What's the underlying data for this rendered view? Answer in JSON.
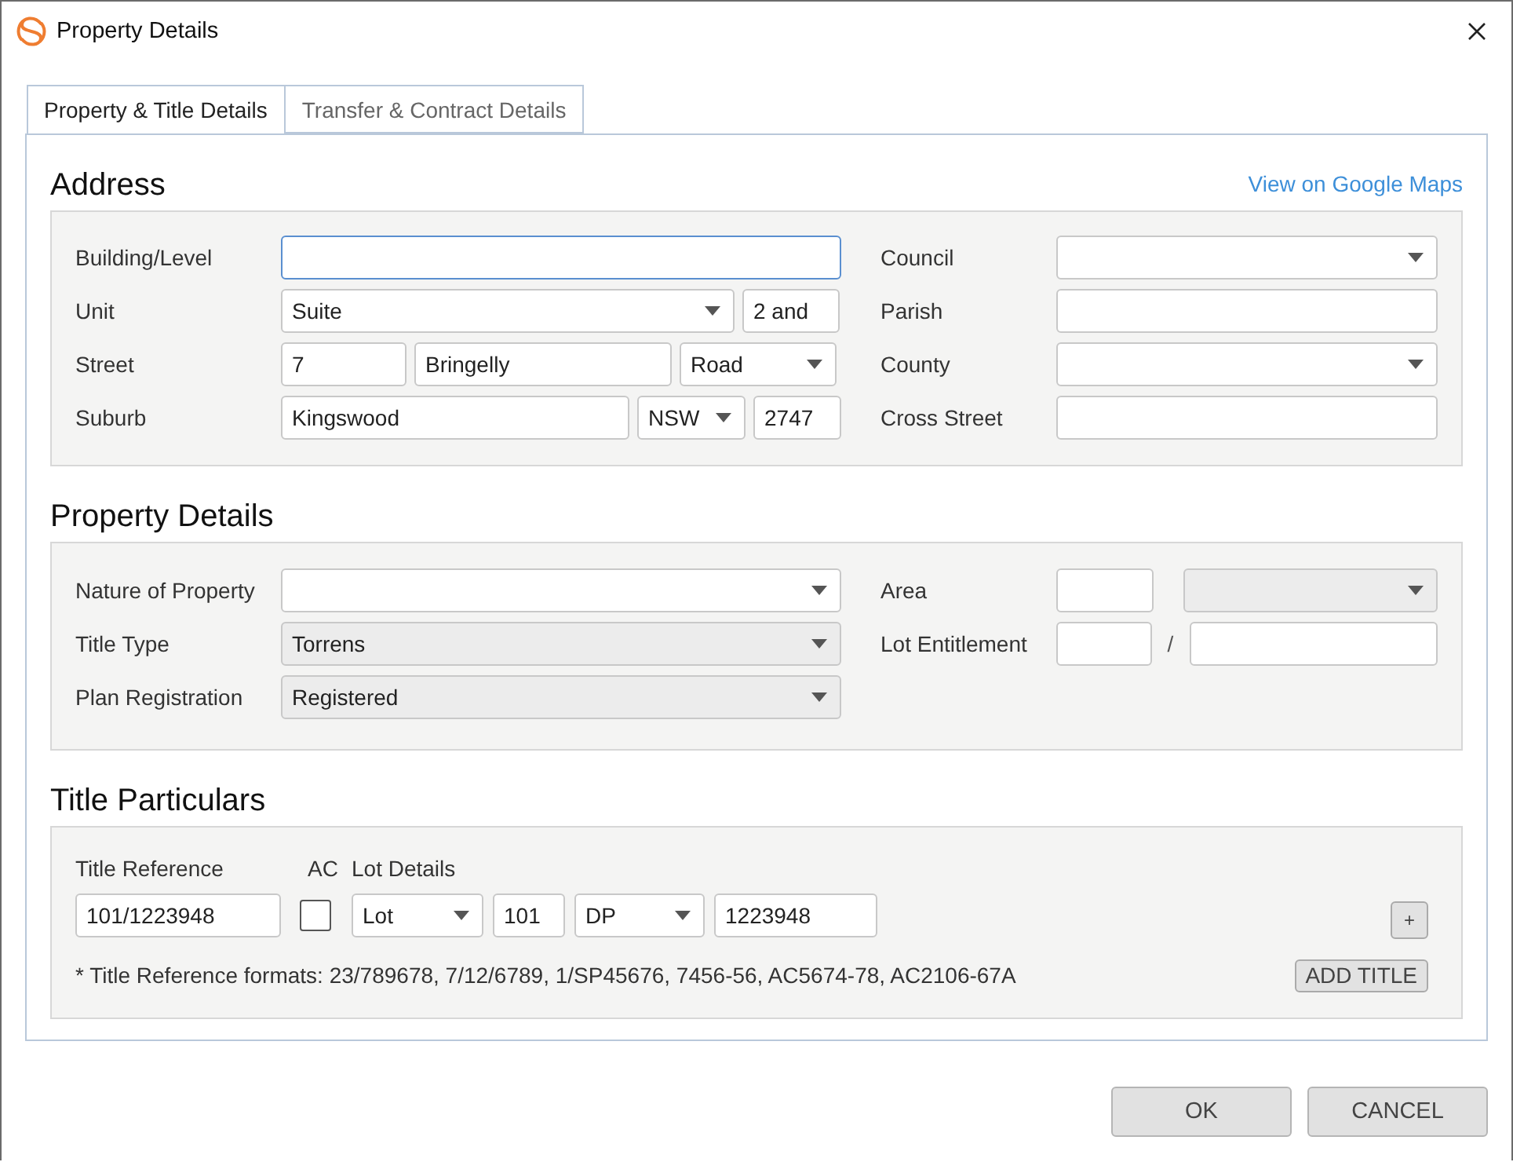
{
  "window": {
    "title": "Property Details"
  },
  "tabs": [
    {
      "label": "Property & Title Details",
      "selected": true
    },
    {
      "label": "Transfer & Contract Details",
      "selected": false
    }
  ],
  "address": {
    "heading": "Address",
    "link": "View on Google Maps",
    "left": [
      {
        "label": "Building/Level",
        "controls": [
          {
            "kind": "input",
            "focused": true
          }
        ]
      },
      {
        "label": "Unit",
        "controls": [
          {
            "kind": "select",
            "value": "Suite"
          },
          {
            "kind": "input",
            "value": "2 and"
          }
        ]
      },
      {
        "label": "Street",
        "controls": [
          {
            "kind": "input",
            "value": "7"
          },
          {
            "kind": "input",
            "value": "Bringelly"
          },
          {
            "kind": "select",
            "value": "Road"
          }
        ]
      },
      {
        "label": "Suburb",
        "controls": [
          {
            "kind": "input",
            "value": "Kingswood"
          },
          {
            "kind": "select",
            "value": "NSW"
          },
          {
            "kind": "input",
            "value": "2747"
          }
        ]
      }
    ],
    "right": [
      {
        "label": "Council",
        "controls": [
          {
            "kind": "select"
          }
        ]
      },
      {
        "label": "Parish",
        "controls": [
          {
            "kind": "input"
          }
        ]
      },
      {
        "label": "County",
        "controls": [
          {
            "kind": "select"
          }
        ]
      },
      {
        "label": "Cross Street",
        "controls": [
          {
            "kind": "input"
          }
        ]
      }
    ]
  },
  "property": {
    "heading": "Property Details",
    "left": [
      {
        "label": "Nature of Property",
        "controls": [
          {
            "kind": "select",
            "disabled": false
          }
        ]
      },
      {
        "label": "Title Type",
        "controls": [
          {
            "kind": "select",
            "value": "Torrens",
            "disabled": true
          }
        ]
      },
      {
        "label": "Plan Registration",
        "controls": [
          {
            "kind": "select",
            "value": "Registered",
            "disabled": true
          }
        ]
      }
    ],
    "right": [
      {
        "label": "Area",
        "controls": [
          {
            "kind": "input"
          },
          {
            "kind": "select",
            "disabled": true
          }
        ]
      },
      {
        "label": "Lot Entitlement",
        "controls": [
          {
            "kind": "input"
          },
          {
            "kind": "separator",
            "value": "/"
          },
          {
            "kind": "input"
          }
        ]
      }
    ]
  },
  "title_particulars": {
    "heading": "Title Particulars",
    "columns": [
      "Title Reference",
      "AC",
      "Lot Details"
    ],
    "reference": {
      "value": "101/1223948"
    },
    "ac": {
      "checked": false
    },
    "lot": [
      {
        "kind": "select",
        "value": "Lot"
      },
      {
        "kind": "input",
        "value": "101"
      },
      {
        "kind": "select",
        "value": "DP"
      },
      {
        "kind": "input",
        "value": "1223948"
      }
    ],
    "add_button": "+",
    "note": "* Title Reference formats: 23/789678, 7/12/6789, 1/SP45676, 7456-56, AC5674-78, AC2106-67A",
    "add_title_button": "ADD TITLE"
  },
  "buttons": [
    "OK",
    "CANCEL"
  ]
}
